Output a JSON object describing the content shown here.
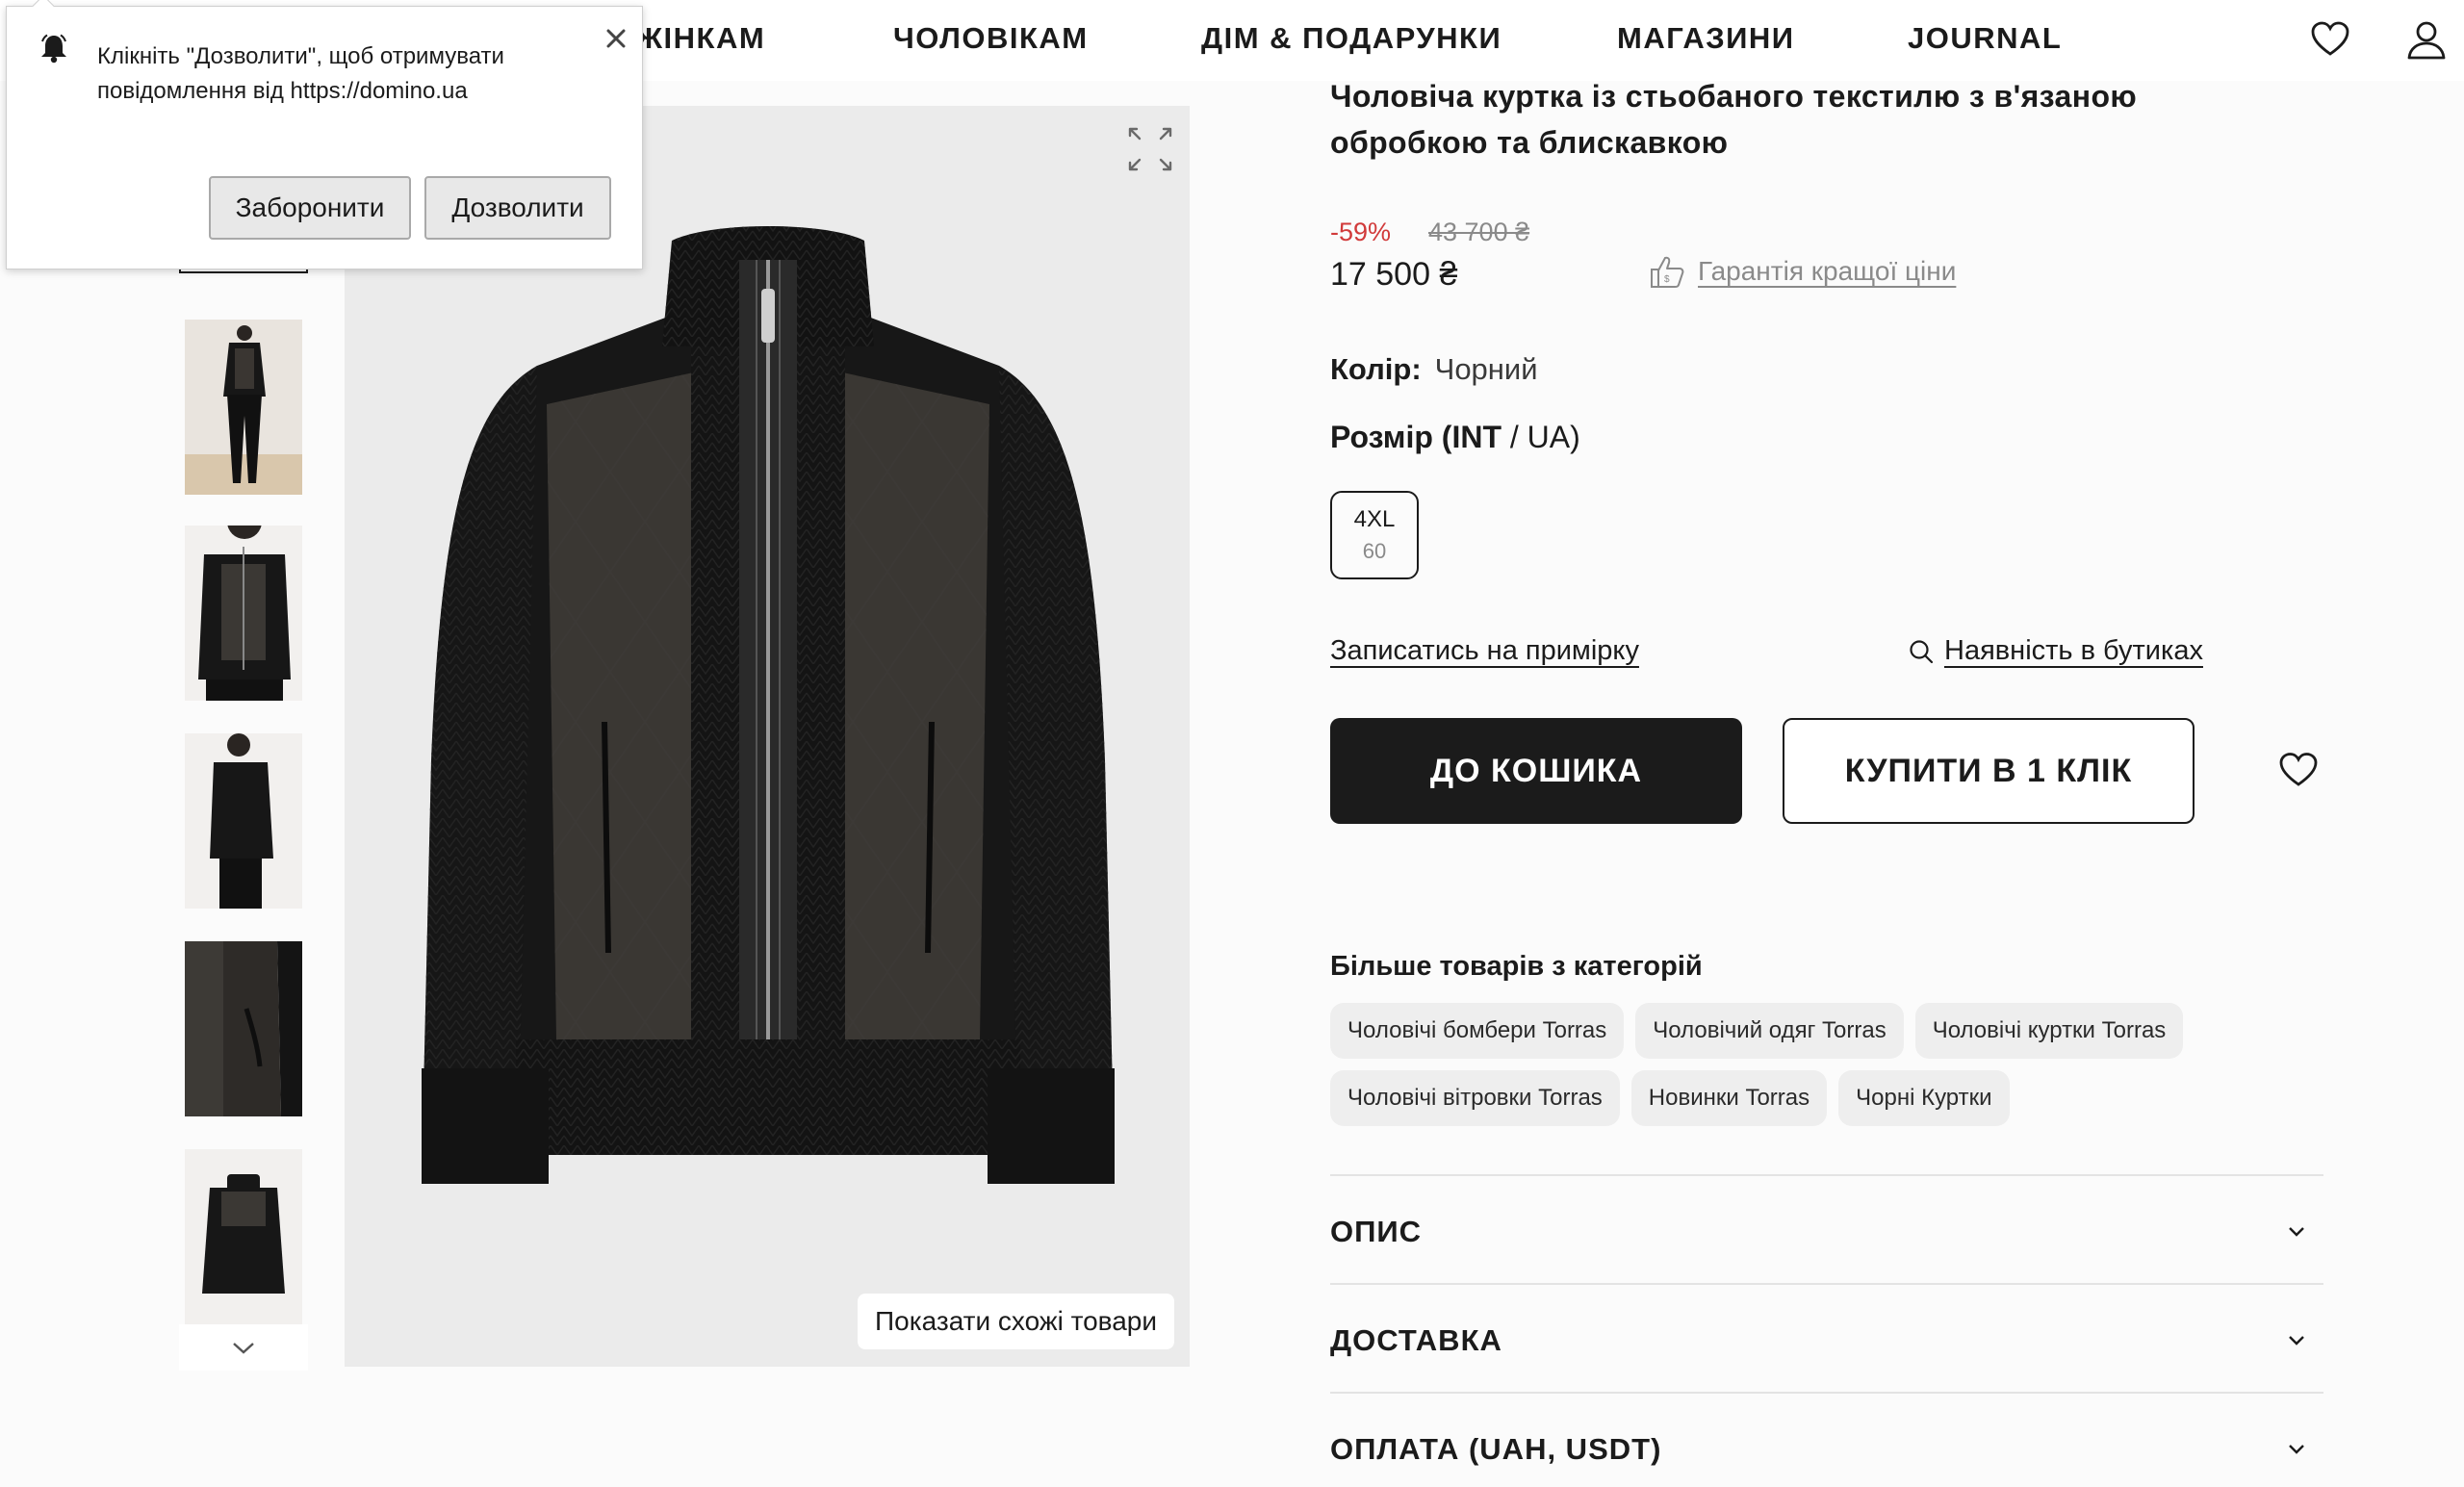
{
  "nav": {
    "items": [
      "ЖІНКАМ",
      "ЧОЛОВІКАМ",
      "ДІМ & ПОДАРУНКИ",
      "МАГАЗИНИ",
      "JOURNAL"
    ],
    "icons": [
      "heart-icon",
      "user-icon"
    ]
  },
  "notification": {
    "text": "Клікніть \"Дозволити\", щоб отримувати повідомлення від https://domino.ua",
    "deny_label": "Заборонити",
    "allow_label": "Дозволити",
    "icons": [
      "bell-icon",
      "close-icon"
    ]
  },
  "gallery": {
    "similar_label": "Показати схожі товари",
    "icons": [
      "expand-icon",
      "chevron-down-icon"
    ]
  },
  "product": {
    "title": "Чоловіча куртка із стьобаного текстилю з в'язаною обробкою та блискавкою",
    "discount": "-59%",
    "old_price": "43 700 ₴",
    "price": "17 500 ₴",
    "guarantee_label": "Гарантія кращої ціни",
    "color_label": "Колір:",
    "color_value": "Чорний",
    "size_label_bold": "Розмір (INT",
    "size_label_rest": " / UA)",
    "size_int": "4XL",
    "size_ua": "60",
    "fitting_label": "Записатись на примірку",
    "stores_label": "Наявність в бутиках",
    "cart_label": "ДО КОШИКА",
    "oneclick_label": "КУПИТИ В 1 КЛІК"
  },
  "more": {
    "title": "Більше товарів з категорій",
    "tags": [
      "Чоловічі бомбери Torras",
      "Чоловічий одяг Torras",
      "Чоловічі куртки Torras",
      "Чоловічі вітровки Torras",
      "Новинки Torras",
      "Чорні Куртки"
    ]
  },
  "accordion": [
    "ОПИС",
    "ДОСТАВКА",
    "ОПЛАТА (UAH, USDT)"
  ],
  "colors": {
    "accent": "#1b1b1b",
    "discount": "#d13a3a",
    "muted": "#8a8a8a",
    "tag_bg": "#eeeeee"
  }
}
